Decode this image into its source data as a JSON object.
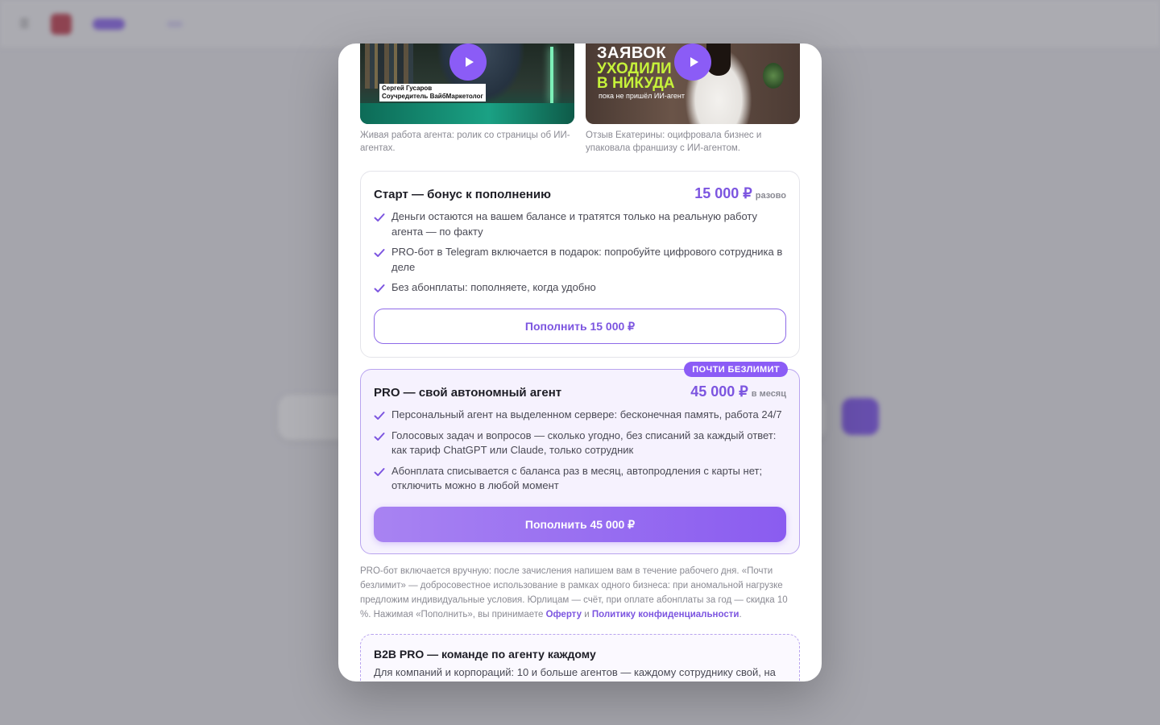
{
  "background": {
    "nav_items": [
      "",
      "",
      ""
    ],
    "brand": "",
    "pill": "",
    "links": [
      "",
      ""
    ],
    "lang": "",
    "tag": ""
  },
  "videos": [
    {
      "overlay_caption": "Сергей Гусаров\nСоучредитель ВайбМаркетолог",
      "caption": "Живая работа агента: ролик со страницы об ИИ-агентах."
    },
    {
      "overlay_line1": "ЗАЯВОК",
      "overlay_line2": "УХОДИЛИ",
      "overlay_line3": "В НИКУДА",
      "overlay_sub": "пока не пришёл ИИ-агент",
      "caption": "Отзыв Екатерины: оцифровала бизнес и упаковала франшизу с ИИ-агентом."
    }
  ],
  "plans": {
    "start": {
      "title": "Старт — бонус к пополнению",
      "price": "15 000 ₽",
      "price_unit": "разово",
      "features": [
        "Деньги остаются на вашем балансе и тратятся только на реальную работу агента — по факту",
        "PRO-бот в Telegram включается в подарок: попробуйте цифрового сотрудника в деле",
        "Без абонплаты: пополняете, когда удобно"
      ],
      "button": "Пополнить 15 000 ₽"
    },
    "pro": {
      "badge": "ПОЧТИ БЕЗЛИМИТ",
      "title": "PRO — свой автономный агент",
      "price": "45 000 ₽",
      "price_unit": "в месяц",
      "features": [
        "Персональный агент на выделенном сервере: бесконечная память, работа 24/7",
        "Голосовых задач и вопросов — сколько угодно, без списаний за каждый ответ: как тариф ChatGPT или Claude, только сотрудник",
        "Абонплата списывается с баланса раз в месяц, автопродления с карты нет; отключить можно в любой момент"
      ],
      "button": "Пополнить 45 000 ₽"
    }
  },
  "note": {
    "text": "PRO-бот включается вручную: после зачисления напишем вам в течение рабочего дня. «Почти безлимит» — добросовестное использование в рамках одного бизнеса: при аномальной нагрузке предложим индивидуальные условия. Юрлицам — счёт, при оплате абонплаты за год — скидка 10 %. Нажимая «Пополнить», вы принимаете ",
    "link_offer": "Оферту",
    "and": " и ",
    "link_privacy": "Политику конфиденциальности",
    "end": "."
  },
  "b2b": {
    "title": "B2B PRO — команде по агенту каждому",
    "desc": "Для компаний и корпораций: 10 и больше агентов — каждому сотруднику свой, на"
  },
  "colors": {
    "accent": "#8b5cf6",
    "accent_text": "#7c55e0",
    "pro_bg": "#f6f2fe",
    "check": "#7c55e0"
  }
}
